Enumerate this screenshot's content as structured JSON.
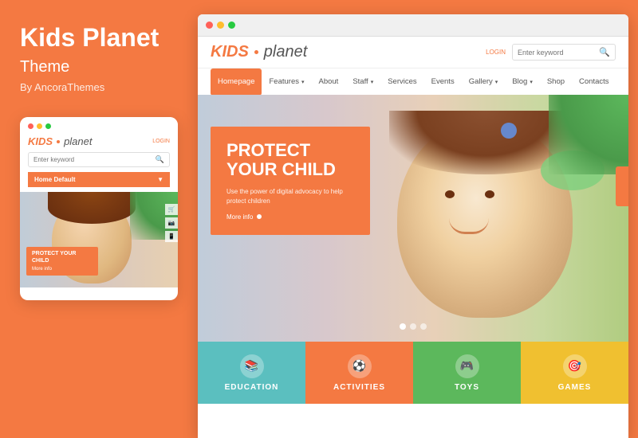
{
  "background": {
    "color": "#f47942"
  },
  "left_panel": {
    "title": "Kids Planet",
    "subtitle": "Theme",
    "by_line": "By AncoraThemes"
  },
  "mobile_mockup": {
    "dots": [
      {
        "color": "#ff6058"
      },
      {
        "color": "#ffbd2e"
      },
      {
        "color": "#28ca41"
      }
    ],
    "logo_kids": "KIDS",
    "logo_planet": "planet",
    "login_label": "LOGIN",
    "search_placeholder": "Enter keyword",
    "nav_label": "Home Default",
    "hero_title": "PROTECT YOUR CHILD",
    "hero_link": "More info"
  },
  "browser": {
    "dots": [
      {
        "color": "#ff6058"
      },
      {
        "color": "#ffbd2e"
      },
      {
        "color": "#28ca41"
      }
    ]
  },
  "site": {
    "logo_kids": "KIDS",
    "logo_planet": "planet",
    "login_label": "LOGIN",
    "search_placeholder": "Enter keyword",
    "nav_items": [
      {
        "label": "Homepage",
        "active": true,
        "has_arrow": false
      },
      {
        "label": "Features",
        "active": false,
        "has_arrow": true
      },
      {
        "label": "About",
        "active": false,
        "has_arrow": false
      },
      {
        "label": "Staff",
        "active": false,
        "has_arrow": true
      },
      {
        "label": "Services",
        "active": false,
        "has_arrow": false
      },
      {
        "label": "Events",
        "active": false,
        "has_arrow": false
      },
      {
        "label": "Gallery",
        "active": false,
        "has_arrow": true
      },
      {
        "label": "Blog",
        "active": false,
        "has_arrow": true
      },
      {
        "label": "Shop",
        "active": false,
        "has_arrow": false
      },
      {
        "label": "Contacts",
        "active": false,
        "has_arrow": false
      }
    ],
    "hero": {
      "title": "PROTECT YOUR CHILD",
      "description": "Use the power of digital advocacy to help protect children",
      "link_label": "More info"
    },
    "bottom_cards": [
      {
        "label": "EDUCATION",
        "color": "#5bbfbf",
        "icon": "📚"
      },
      {
        "label": "ACTIVITIES",
        "color": "#f47942",
        "icon": "⚽"
      },
      {
        "label": "TOYS",
        "color": "#5cb85c",
        "icon": "🎮"
      },
      {
        "label": "GAMES",
        "color": "#f0c030",
        "icon": "🎯"
      }
    ]
  }
}
